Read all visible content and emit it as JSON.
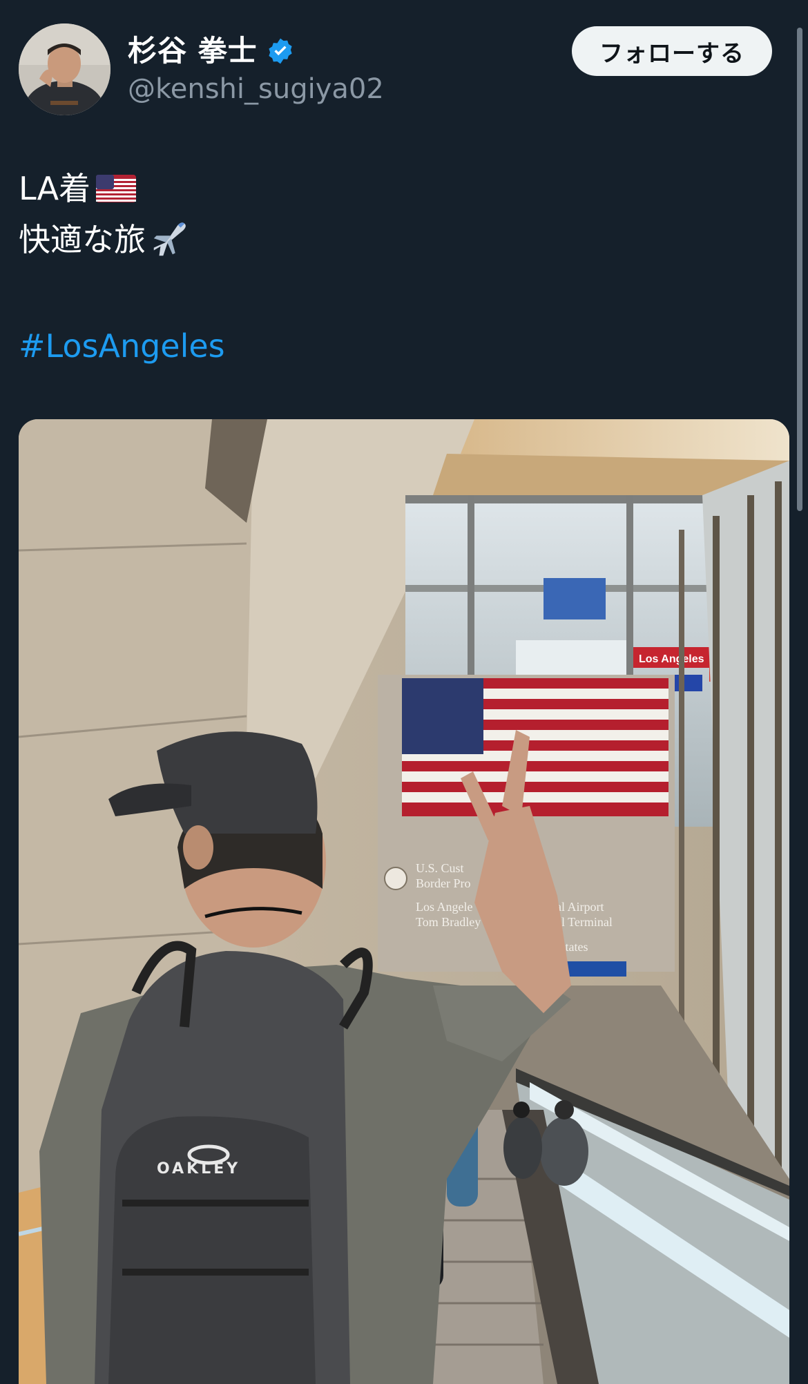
{
  "author": {
    "display_name": "杉谷 拳士",
    "handle": "@kenshi_sugiya02",
    "verified": true
  },
  "follow_button": {
    "label": "フォローする"
  },
  "tweet": {
    "line1_text": "LA着",
    "line1_emoji": "us-flag-emoji",
    "line2_text": "快適な旅",
    "line2_emoji": "airplane-emoji",
    "hashtag": "#LosAngeles"
  },
  "media": {
    "sign_lines": [
      "U.S. Cust",
      "Border Pro",
      "Los Angele",
      "Tom Bradley",
      "onal Airport",
      "onal Terminal",
      "ed States"
    ],
    "backpack_brand": "OAKLEY",
    "store_sign": "Los Angeles"
  },
  "colors": {
    "background": "#15202b",
    "link": "#1d9bf0",
    "secondary_text": "#8b98a5",
    "verified": "#1d9bf0",
    "follow_button_bg": "#eff3f4"
  }
}
